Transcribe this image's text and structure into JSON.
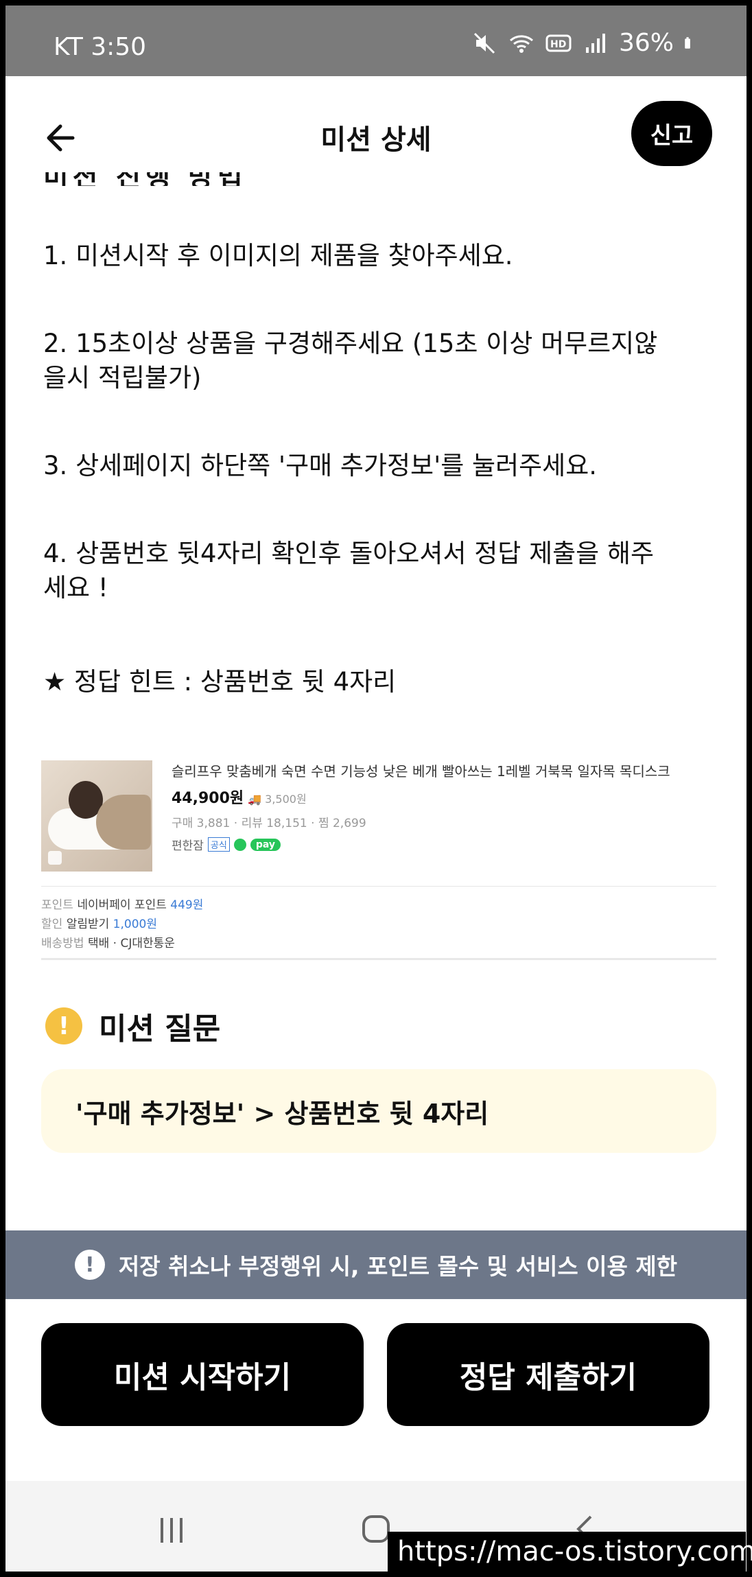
{
  "status_bar": {
    "carrier_time": "KT 3:50",
    "battery": "36%"
  },
  "header": {
    "title": "미션 상세",
    "report_label": "신고"
  },
  "content": {
    "cut_heading": "미션 진행 방법",
    "steps": [
      "1. 미션시작 후 이미지의 제품을 찾아주세요.",
      "2. 15초이상 상품을 구경해주세요 (15초 이상 머무르지않을시 적립불가)",
      "3. 상세페이지 하단쪽 '구매 추가정보'를 눌러주세요.",
      "4. 상품번호 뒷4자리 확인후 돌아오셔서 정답 제출을 해주세요 !"
    ],
    "hint": "★ 정답 힌트 : 상품번호 뒷 4자리"
  },
  "product": {
    "name": "슬리프우 맞춤베개 숙면 수면 기능성 낮은 베개 빨아쓰는 1레벨 거북목 일자목 목디스크",
    "price": "44,900원",
    "shipping": "3,500원",
    "meta": "구매 3,881 · 리뷰 18,151 · 찜 2,699",
    "seller": "편한잠",
    "official_tag": "공식",
    "pay_tag": "pay",
    "point_label": "포인트",
    "point_value": "네이버페이 포인트",
    "point_amount": "449원",
    "discount_label": "할인",
    "discount_value": "알림받기",
    "discount_amount": "1,000원",
    "delivery_label": "배송방법",
    "delivery_value": "택배 · CJ대한통운"
  },
  "question": {
    "icon": "!",
    "title": "미션 질문",
    "text": "'구매 추가정보' > 상품번호 뒷 4자리"
  },
  "warning": {
    "icon": "!",
    "text": "저장 취소나 부정행위 시, 포인트 몰수 및 서비스 이용 제한"
  },
  "buttons": {
    "start": "미션 시작하기",
    "submit": "정답 제출하기"
  },
  "watermark": "https://mac-os.tistory.com"
}
